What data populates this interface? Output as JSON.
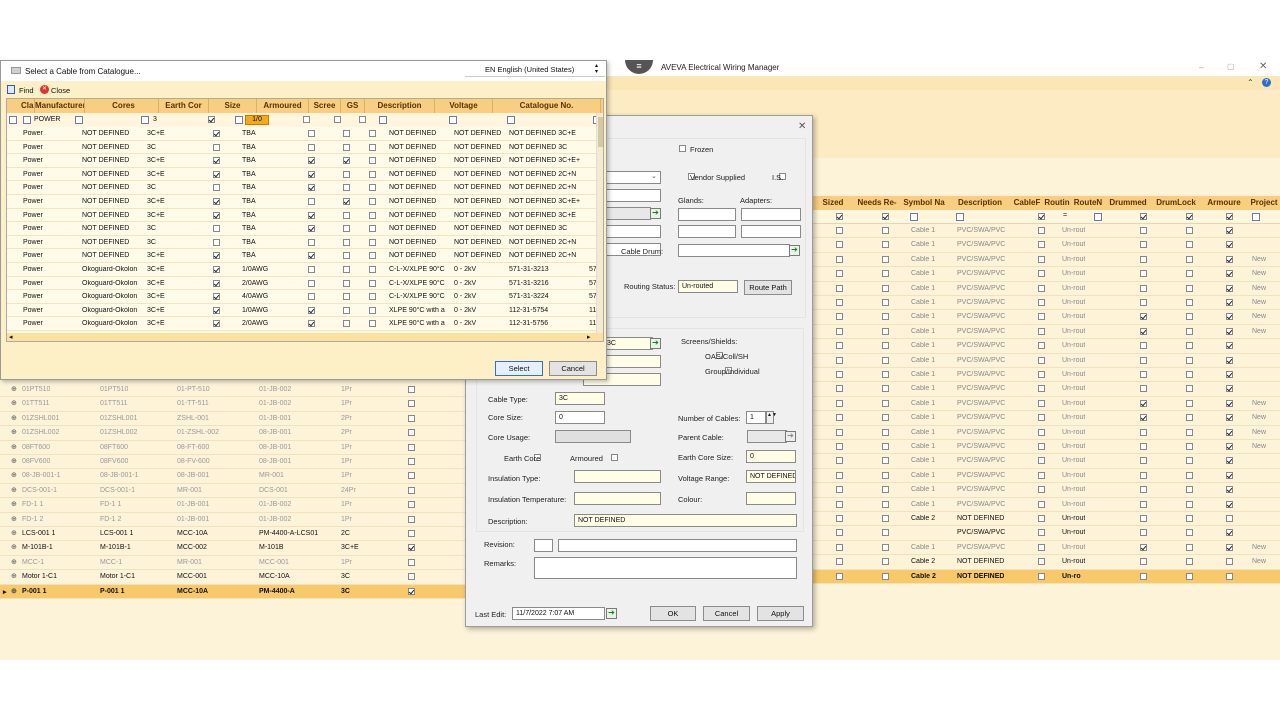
{
  "app": {
    "title": "AVEVA Electrical Wiring Manager"
  },
  "catalogue": {
    "title": "Select a Cable from Catalogue...",
    "language": "EN English (United States)",
    "find": "Find",
    "close": "Close",
    "headers": [
      "Class",
      "Manufacturer",
      "Cores",
      "Earth Cor",
      "Size",
      "Armoured",
      "Scree",
      "GS",
      "Description",
      "Voltage",
      "Catalogue No.",
      "U:"
    ],
    "filter": {
      "class": "POWER",
      "cores": "3",
      "size": "1/0"
    },
    "rows": [
      [
        "Power",
        "NOT DEFINED",
        "3C+E",
        1,
        "TBA",
        0,
        0,
        0,
        "NOT DEFINED",
        "NOT DEFINED",
        "NOT DEFINED 3C+E",
        ""
      ],
      [
        "Power",
        "NOT DEFINED",
        "3C",
        0,
        "TBA",
        0,
        0,
        0,
        "NOT DEFINED",
        "NOT DEFINED",
        "NOT DEFINED 3C",
        ""
      ],
      [
        "Power",
        "NOT DEFINED",
        "3C+E",
        1,
        "TBA",
        1,
        1,
        0,
        "NOT DEFINED",
        "NOT DEFINED",
        "NOT DEFINED 3C+E+",
        ""
      ],
      [
        "Power",
        "NOT DEFINED",
        "3C+E",
        1,
        "TBA",
        1,
        0,
        0,
        "NOT DEFINED",
        "NOT DEFINED",
        "NOT DEFINED 2C+N",
        ""
      ],
      [
        "Power",
        "NOT DEFINED",
        "3C",
        0,
        "TBA",
        1,
        0,
        0,
        "NOT DEFINED",
        "NOT DEFINED",
        "NOT DEFINED 2C+N",
        ""
      ],
      [
        "Power",
        "NOT DEFINED",
        "3C+E",
        1,
        "TBA",
        0,
        1,
        0,
        "NOT DEFINED",
        "NOT DEFINED",
        "NOT DEFINED 3C+E+",
        ""
      ],
      [
        "Power",
        "NOT DEFINED",
        "3C+E",
        1,
        "TBA",
        1,
        0,
        0,
        "NOT DEFINED",
        "NOT DEFINED",
        "NOT DEFINED 3C+E",
        ""
      ],
      [
        "Power",
        "NOT DEFINED",
        "3C",
        0,
        "TBA",
        1,
        0,
        0,
        "NOT DEFINED",
        "NOT DEFINED",
        "NOT DEFINED 3C",
        ""
      ],
      [
        "Power",
        "NOT DEFINED",
        "3C",
        0,
        "TBA",
        0,
        0,
        0,
        "NOT DEFINED",
        "NOT DEFINED",
        "NOT DEFINED 2C+N",
        ""
      ],
      [
        "Power",
        "NOT DEFINED",
        "3C+E",
        1,
        "TBA",
        1,
        0,
        0,
        "NOT DEFINED",
        "NOT DEFINED",
        "NOT DEFINED 2C+N",
        ""
      ],
      [
        "Power",
        "Okoguard-Okolon",
        "3C+E",
        1,
        "1/0AWG",
        0,
        0,
        0,
        "C-L-X/XLPE 90°C",
        "0 - 2kV",
        "571-31-3213",
        "571"
      ],
      [
        "Power",
        "Okoguard-Okolon",
        "3C+E",
        1,
        "2/0AWG",
        0,
        0,
        0,
        "C-L-X/XLPE 90°C",
        "0 - 2kV",
        "571-31-3216",
        "571"
      ],
      [
        "Power",
        "Okoguard-Okolon",
        "3C+E",
        1,
        "4/0AWG",
        0,
        0,
        0,
        "C-L-X/XLPE 90°C",
        "0 - 2kV",
        "571-31-3224",
        "571"
      ],
      [
        "Power",
        "Okoguard-Okolon",
        "3C+E",
        1,
        "1/0AWG",
        1,
        0,
        0,
        "XLPE 90°C with a",
        "0 - 2kV",
        "112-31-5754",
        "112"
      ],
      [
        "Power",
        "Okoguard-Okolon",
        "3C+E",
        1,
        "2/0AWG",
        1,
        0,
        0,
        "XLPE 90°C with a",
        "0 - 2kV",
        "112-31-5756",
        "112"
      ],
      [
        "Power",
        "Okoguard-Okolon",
        "3C+E",
        1,
        "4/0AWG",
        1,
        0,
        0,
        "XLPE 90°C with a",
        "0 - 2kV",
        "112-31-5760",
        "112"
      ]
    ],
    "select": "Select",
    "cancel": "Cancel"
  },
  "edit": {
    "frozen": "Frozen",
    "vendor_supplied": "Vendor Supplied",
    "is": "I.S.",
    "glands": "Glands:",
    "adapters": "Adapters:",
    "cable_drum": "Cable Drum:",
    "routing_status": "Routing Status:",
    "routing_value": "Un-routed",
    "route_path": "Route Path",
    "screens": "Screens/Shields:",
    "oas": "OAS/Coll/SH",
    "group": "Group/Individual",
    "spec_value": "3C",
    "cable_type": "Cable Type:",
    "cable_type_value": "3C",
    "core_size": "Core Size:",
    "core_size_value": "0",
    "core_usage": "Core Usage:",
    "earth_core": "Earth Core",
    "armoured": "Armoured",
    "insulation_type": "Insulation Type:",
    "insulation_temp": "Insulation Temperature:",
    "description": "Description:",
    "description_value": "NOT DEFINED",
    "num_cables": "Number of Cables:",
    "num_cables_value": "1",
    "parent_cable": "Parent Cable:",
    "earth_core_size": "Earth Core Size:",
    "earth_core_size_value": "0",
    "voltage_range": "Voltage Range:",
    "voltage_range_value": "NOT DEFINED",
    "colour": "Colour:",
    "revision": "Revision:",
    "remarks": "Remarks:",
    "last_edit": "Last Edit:",
    "last_edit_value": "11/7/2022 7:07 AM",
    "ok": "OK",
    "cancel": "Cancel",
    "apply": "Apply"
  },
  "right_grid": {
    "headers": [
      "Sized",
      "Needs Re-",
      "Symbol Na",
      "Description",
      "CableF",
      "Routin",
      "RouteN",
      "Drummed",
      "DrumLock",
      "Armoure",
      "Project"
    ],
    "rows": [
      [
        "Cable 1",
        "PVC/SWA/PVC",
        "Un-rout",
        0,
        1,
        ""
      ],
      [
        "Cable 1",
        "PVC/SWA/PVC",
        "Un-rout",
        0,
        1,
        ""
      ],
      [
        "Cable 1",
        "PVC/SWA/PVC",
        "Un-rout",
        0,
        1,
        "New"
      ],
      [
        "Cable 1",
        "PVC/SWA/PVC",
        "Un-rout",
        0,
        1,
        "New"
      ],
      [
        "Cable 1",
        "PVC/SWA/PVC",
        "Un-rout",
        0,
        1,
        "New"
      ],
      [
        "Cable 1",
        "PVC/SWA/PVC",
        "Un-rout",
        0,
        1,
        "New"
      ],
      [
        "Cable 1",
        "PVC/SWA/PVC",
        "Un-rout",
        1,
        1,
        "New"
      ],
      [
        "Cable 1",
        "PVC/SWA/PVC",
        "Un-rout",
        1,
        1,
        "New"
      ],
      [
        "Cable 1",
        "PVC/SWA/PVC",
        "Un-rout",
        0,
        1,
        ""
      ],
      [
        "Cable 1",
        "PVC/SWA/PVC",
        "Un-rout",
        0,
        1,
        ""
      ],
      [
        "Cable 1",
        "PVC/SWA/PVC",
        "Un-rout",
        0,
        1,
        ""
      ],
      [
        "Cable 1",
        "PVC/SWA/PVC",
        "Un-rout",
        0,
        1,
        ""
      ],
      [
        "Cable 1",
        "PVC/SWA/PVC",
        "Un-rout",
        1,
        1,
        "New"
      ],
      [
        "Cable 1",
        "PVC/SWA/PVC",
        "Un-rout",
        1,
        1,
        "New"
      ],
      [
        "Cable 1",
        "PVC/SWA/PVC",
        "Un-rout",
        0,
        1,
        "New"
      ],
      [
        "Cable 1",
        "PVC/SWA/PVC",
        "Un-rout",
        0,
        1,
        "New"
      ],
      [
        "Cable 1",
        "PVC/SWA/PVC",
        "Un-rout",
        0,
        1,
        ""
      ],
      [
        "Cable 1",
        "PVC/SWA/PVC",
        "Un-rout",
        0,
        1,
        ""
      ],
      [
        "Cable 1",
        "PVC/SWA/PVC",
        "Un-rout",
        0,
        1,
        ""
      ],
      [
        "Cable 1",
        "PVC/SWA/PVC",
        "Un-rout",
        0,
        1,
        ""
      ],
      [
        "Cable 2",
        "NOT DEFINED",
        "Un-rout",
        0,
        0,
        ""
      ],
      [
        "",
        "PVC/SWA/PVC",
        "Un-rout",
        0,
        1,
        ""
      ],
      [
        "Cable 1",
        "PVC/SWA/PVC",
        "Un-rout",
        1,
        1,
        "New"
      ],
      [
        "Cable 2",
        "NOT DEFINED",
        "Un-rout",
        0,
        0,
        "New"
      ],
      [
        "Cable 2",
        "NOT DEFINED",
        "Un-ro",
        0,
        0,
        ""
      ]
    ]
  },
  "left_grid": {
    "rows": [
      [
        "01PT510",
        "01PT510",
        "01-PT-510",
        "01-JB-002",
        "1Pr",
        0,
        "g"
      ],
      [
        "01TT511",
        "01TT511",
        "01-TT-511",
        "01-JB-002",
        "1Pr",
        0,
        "g"
      ],
      [
        "01ZSHL001",
        "01ZSHL001",
        "ZSHL-001",
        "01-JB-001",
        "2Pr",
        0,
        "g"
      ],
      [
        "01ZSHL002",
        "01ZSHL002",
        "01-ZSHL-002",
        "08-JB-001",
        "2Pr",
        0,
        "g"
      ],
      [
        "08FT600",
        "08FT600",
        "08-FT-600",
        "08-JB-001",
        "1Pr",
        0,
        "g"
      ],
      [
        "08FV600",
        "08FV600",
        "08-FV-600",
        "08-JB-001",
        "1Pr",
        0,
        "g"
      ],
      [
        "08-JB-001-1",
        "08-JB-001-1",
        "08-JB-001",
        "MR-001",
        "1Pr",
        0,
        "g"
      ],
      [
        "DCS-001-1",
        "DCS-001-1",
        "MR-001",
        "DCS-001",
        "24Pr",
        0,
        "g"
      ],
      [
        "FD-1 1",
        "FD-1 1",
        "01-JB-001",
        "01-JB-002",
        "1Pr",
        0,
        "g"
      ],
      [
        "FD-1 2",
        "FD-1 2",
        "01-JB-001",
        "01-JB-002",
        "1Pr",
        0,
        "g"
      ],
      [
        "LCS-001 1",
        "LCS-001 1",
        "MCC-10A",
        "PM-4400-A-LCS01",
        "2C",
        0,
        "n"
      ],
      [
        "M-101B-1",
        "M-101B-1",
        "MCC-002",
        "M-101B",
        "3C+E",
        1,
        "n"
      ],
      [
        "MCC-1",
        "MCC-1",
        "MR-001",
        "MCC-001",
        "1Pr",
        0,
        "g"
      ],
      [
        "Motor 1-C1",
        "Motor 1-C1",
        "MCC-001",
        "MCC-10A",
        "3C",
        0,
        "n"
      ],
      [
        "P-001 1",
        "P-001 1",
        "MCC-10A",
        "PM-4400-A",
        "3C",
        1,
        "b"
      ]
    ]
  },
  "colors": {
    "header": "#f8cf80",
    "selected_row": "#f7c96b",
    "accent": "#f4a820"
  }
}
